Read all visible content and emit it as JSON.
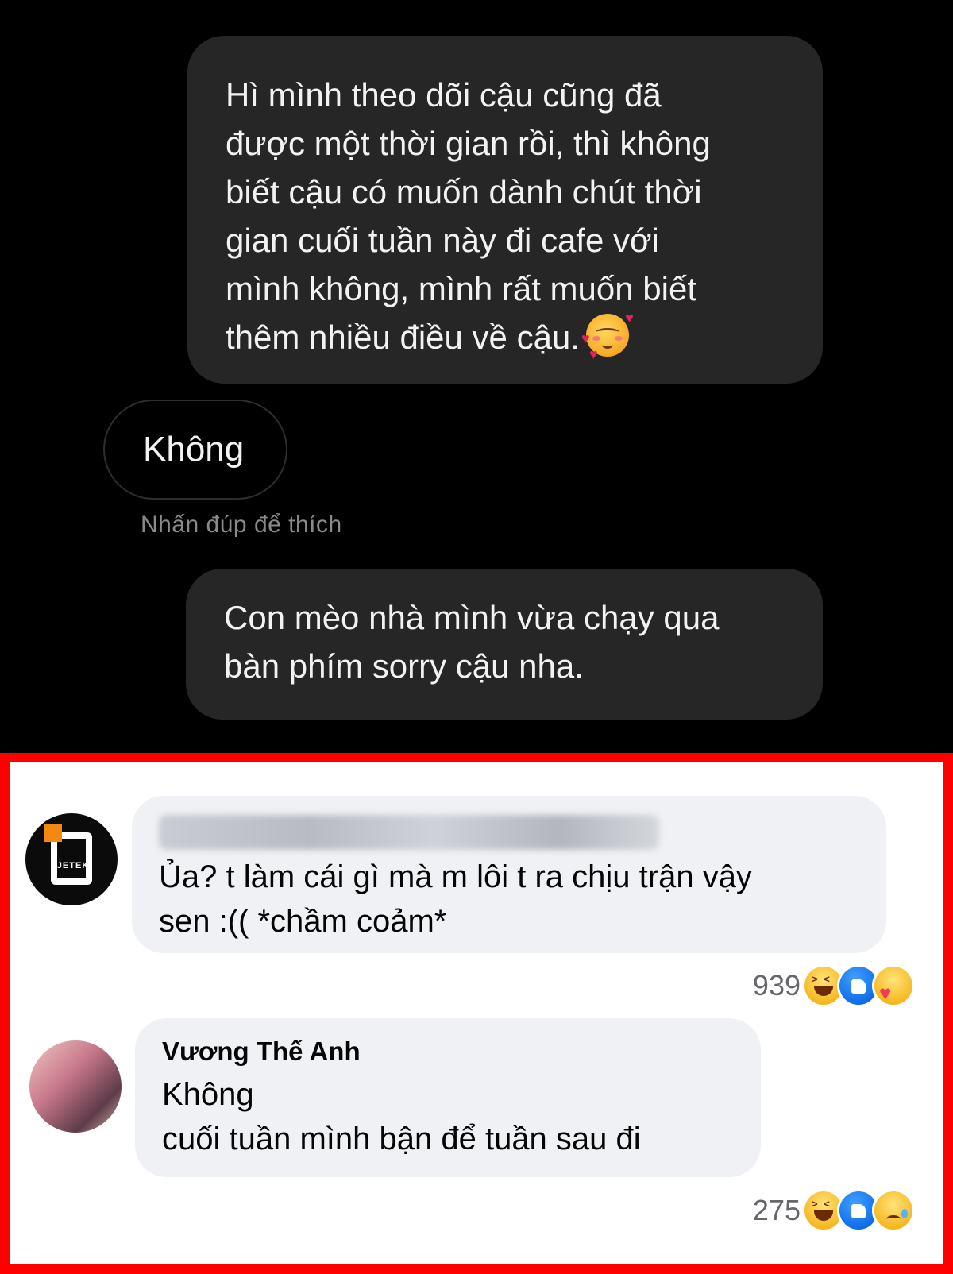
{
  "chat": {
    "message_1": {
      "lines": [
        "Hì mình theo dõi cậu cũng đã",
        "được một thời gian rồi, thì không",
        "biết cậu có muốn dành chút thời",
        "gian cuối tuần này đi cafe với",
        "mình không, mình rất muốn biết",
        "thêm nhiều điều về cậu."
      ],
      "emoji": "smiling-face-with-hearts"
    },
    "reply": "Không",
    "reply_hint": "Nhấn đúp để thích",
    "message_2": {
      "lines": [
        "Con mèo nhà mình vừa chạy qua",
        "bàn phím sorry cậu nha."
      ]
    }
  },
  "comments": [
    {
      "author_redacted": true,
      "avatar_label": "JETEK",
      "lines": [
        "Ủa? t làm cái gì mà m lôi t ra chịu trận vậy",
        "sen :(( *chầm coảm*"
      ],
      "reaction_count": "939",
      "reactions": [
        "haha",
        "like",
        "care"
      ]
    },
    {
      "author": "Vương Thế Anh",
      "lines": [
        "Không",
        "cuối tuần mình bận để tuần sau đi"
      ],
      "reaction_count": "275",
      "reactions": [
        "haha",
        "like",
        "sad"
      ]
    }
  ],
  "colors": {
    "chat_bg": "#000000",
    "bubble_bg": "#262626",
    "highlight_border": "#ff0000",
    "comment_bubble_bg": "#eff1f4",
    "like_blue": "#0a66e8"
  }
}
